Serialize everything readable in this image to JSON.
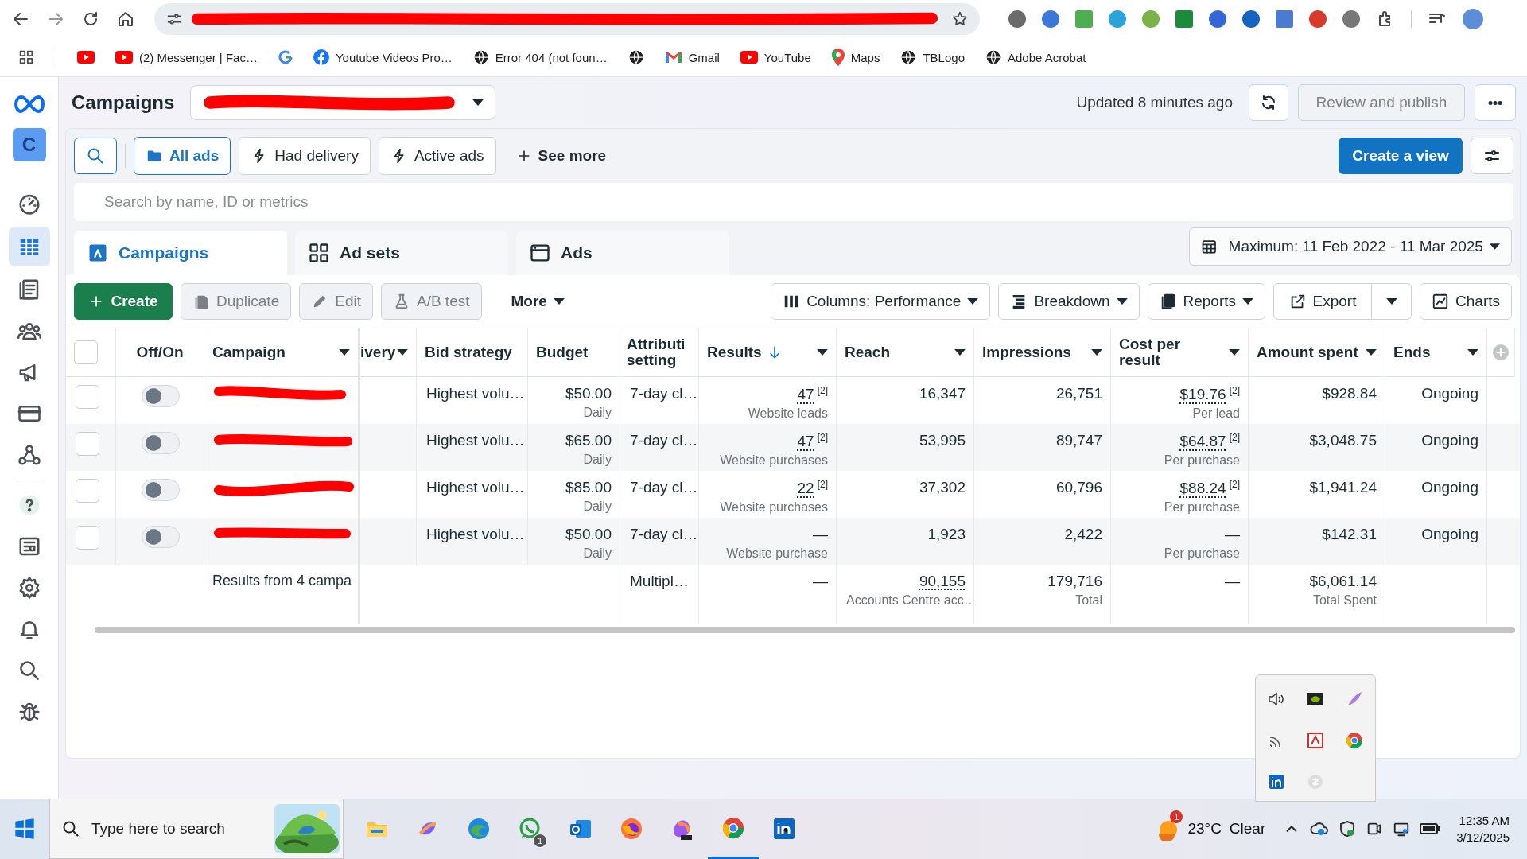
{
  "browser": {
    "bookmarks": [
      {
        "kind": "youtube"
      },
      {
        "kind": "youtube",
        "label": "(2) Messenger | Fac…"
      },
      {
        "kind": "google"
      },
      {
        "kind": "facebook",
        "label": "Youtube Videos Pro…"
      },
      {
        "kind": "globe",
        "label": "Error 404 (not foun…"
      },
      {
        "kind": "globe"
      },
      {
        "kind": "gmail",
        "label": "Gmail"
      },
      {
        "kind": "youtube",
        "label": "YouTube"
      },
      {
        "kind": "maps",
        "label": "Maps"
      },
      {
        "kind": "globe",
        "label": "TBLogo"
      },
      {
        "kind": "globe",
        "label": "Adobe Acrobat"
      }
    ]
  },
  "nav": {
    "account_initial": "C",
    "items": [
      {
        "kind": "dashboard",
        "selected": false
      },
      {
        "kind": "table",
        "selected": true
      },
      {
        "kind": "pages",
        "selected": false
      },
      {
        "kind": "audiences",
        "selected": false
      },
      {
        "kind": "megaphone",
        "selected": false
      },
      {
        "kind": "billing",
        "selected": false
      },
      {
        "kind": "network",
        "selected": false
      },
      {
        "kind": "help",
        "selected": false
      },
      {
        "kind": "news",
        "selected": false
      },
      {
        "kind": "settings",
        "selected": false
      },
      {
        "kind": "notifications",
        "selected": false
      },
      {
        "kind": "search",
        "selected": false
      },
      {
        "kind": "bug",
        "selected": false
      }
    ]
  },
  "header": {
    "title": "Campaigns",
    "updated": "Updated 8 minutes ago",
    "publish": {
      "label": "Review and publish",
      "disabled": true
    }
  },
  "filters": {
    "chips": [
      {
        "kind": "folder",
        "label": "All ads",
        "selected": true
      },
      {
        "kind": "bolt",
        "label": "Had delivery",
        "selected": false
      },
      {
        "kind": "bolt",
        "label": "Active ads",
        "selected": false
      }
    ],
    "see_more": "See more",
    "create_view": "Create a view"
  },
  "search": {
    "placeholder": "Search by name, ID or metrics"
  },
  "levels": [
    {
      "kind": "campaigns",
      "label": "Campaigns",
      "selected": true
    },
    {
      "kind": "adsets",
      "label": "Ad sets",
      "selected": false
    },
    {
      "kind": "ads",
      "label": "Ads",
      "selected": false
    }
  ],
  "date_range": "Maximum: 11 Feb 2022 - 11 Mar 2025",
  "toolbar": {
    "create": "Create",
    "actions": [
      {
        "kind": "duplicate",
        "label": "Duplicate",
        "disabled": true
      },
      {
        "kind": "edit",
        "label": "Edit",
        "disabled": true
      },
      {
        "kind": "abtest",
        "label": "A/B test",
        "disabled": true
      }
    ],
    "more": "More",
    "views": [
      {
        "kind": "columns",
        "label": "Columns: Performance",
        "dropdown": true,
        "split": false
      },
      {
        "kind": "breakdown",
        "label": "Breakdown",
        "dropdown": true,
        "split": false
      },
      {
        "kind": "reports",
        "label": "Reports",
        "dropdown": true,
        "split": false
      },
      {
        "kind": "export",
        "label": "Export",
        "dropdown": true,
        "split": true
      },
      {
        "kind": "charts",
        "label": "Charts",
        "dropdown": false,
        "split": false
      }
    ]
  },
  "table": {
    "all_checked": false,
    "columns": [
      {
        "label": "Off/On",
        "menu": false
      },
      {
        "label": "Campaign",
        "menu": true
      },
      {
        "label": "ivery",
        "menu": true
      },
      {
        "label": "Bid strategy",
        "menu": false
      },
      {
        "label": "Budget",
        "menu": false
      },
      {
        "label": "Attributi setting",
        "menu": false
      },
      {
        "label": "Results",
        "menu": true,
        "sorted": true
      },
      {
        "label": "Reach",
        "menu": true
      },
      {
        "label": "Impressions",
        "menu": true
      },
      {
        "label": "Cost per result",
        "menu": true
      },
      {
        "label": "Amount spent",
        "menu": true
      },
      {
        "label": "Ends",
        "menu": true
      }
    ],
    "rows": [
      {
        "checked": false,
        "on": false,
        "bid_strategy": "Highest volu…",
        "budget": "$50.00",
        "budget_period": "Daily",
        "attribution": "7-day cl…",
        "results": "47",
        "results_note": "[2]",
        "results_label": "Website leads",
        "reach": "16,347",
        "impressions": "26,751",
        "cost": "$19.76",
        "cost_note": "[2]",
        "cost_label": "Per lead",
        "spent": "$928.84",
        "ends": "Ongoing"
      },
      {
        "checked": false,
        "on": false,
        "bid_strategy": "Highest volu…",
        "budget": "$65.00",
        "budget_period": "Daily",
        "attribution": "7-day cl…",
        "results": "47",
        "results_note": "[2]",
        "results_label": "Website purchases",
        "reach": "53,995",
        "impressions": "89,747",
        "cost": "$64.87",
        "cost_note": "[2]",
        "cost_label": "Per purchase",
        "spent": "$3,048.75",
        "ends": "Ongoing"
      },
      {
        "checked": false,
        "on": false,
        "bid_strategy": "Highest volu…",
        "budget": "$85.00",
        "budget_period": "Daily",
        "attribution": "7-day cl…",
        "results": "22",
        "results_note": "[2]",
        "results_label": "Website purchases",
        "reach": "37,302",
        "impressions": "60,796",
        "cost": "$88.24",
        "cost_note": "[2]",
        "cost_label": "Per purchase",
        "spent": "$1,941.24",
        "ends": "Ongoing"
      },
      {
        "checked": false,
        "on": false,
        "bid_strategy": "Highest volu…",
        "budget": "$50.00",
        "budget_period": "Daily",
        "attribution": "7-day cl…",
        "results": "—",
        "results_label": "Website purchase",
        "reach": "1,923",
        "impressions": "2,422",
        "cost": "—",
        "cost_label": "Per purchase",
        "spent": "$142.31",
        "ends": "Ongoing"
      }
    ],
    "summary": {
      "label": "Results from 4 campa",
      "attribution": "Multipl…",
      "results": "—",
      "reach": "90,155",
      "reach_label": "Accounts Centre acc…",
      "impressions": "179,716",
      "impressions_label": "Total",
      "cost": "—",
      "spent": "$6,061.14",
      "spent_label": "Total Spent"
    }
  },
  "taskbar": {
    "search_placeholder": "Type here to search",
    "apps": [
      {
        "kind": "explorer",
        "active": false
      },
      {
        "kind": "copilot",
        "active": false
      },
      {
        "kind": "edge",
        "active": false
      },
      {
        "kind": "whatsapp",
        "active": false,
        "badge": "1"
      },
      {
        "kind": "outlook",
        "active": false
      },
      {
        "kind": "firefox",
        "active": false
      },
      {
        "kind": "office",
        "active": false
      },
      {
        "kind": "chrome",
        "active": true
      },
      {
        "kind": "linkedin",
        "active": false
      }
    ],
    "weather": {
      "badge": "1",
      "temperature": "23°C",
      "condition": "Clear"
    },
    "clock": {
      "time": "12:35 AM",
      "date": "3/12/2025"
    }
  }
}
